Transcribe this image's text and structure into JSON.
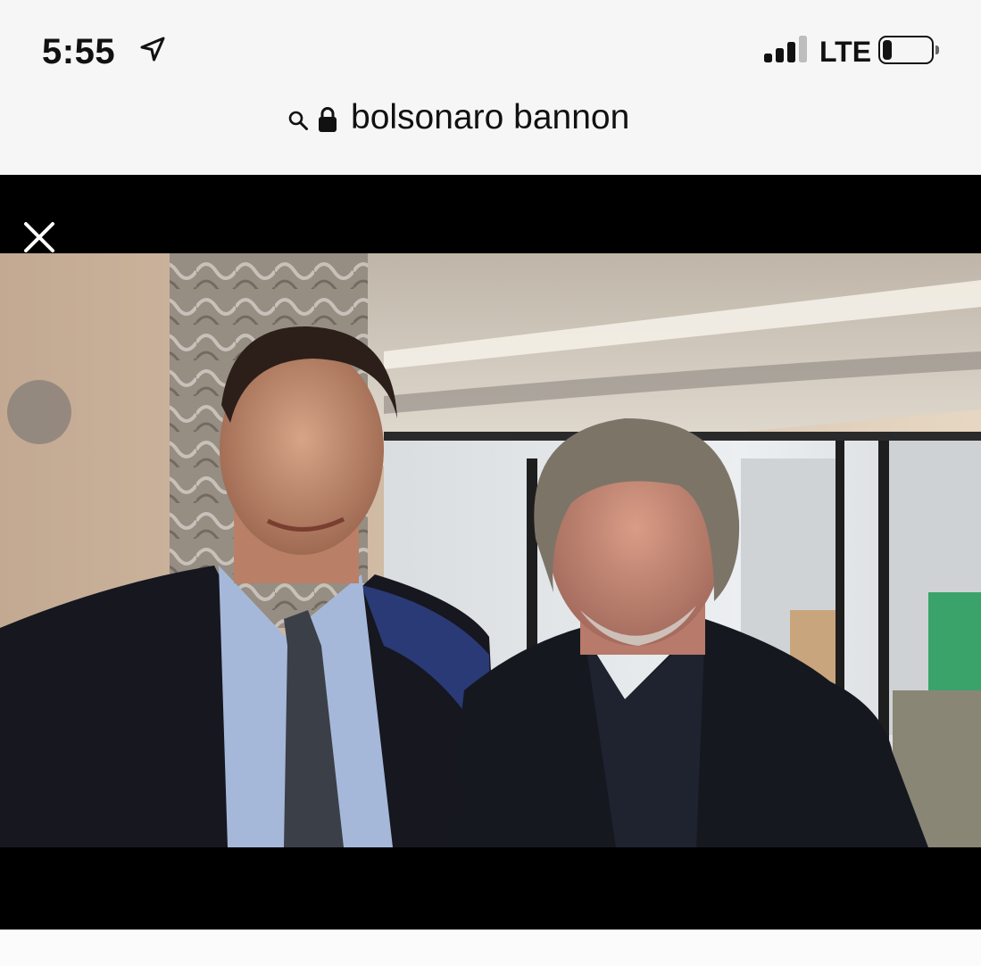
{
  "status_bar": {
    "time": "5:55",
    "carrier": "LTE",
    "location_icon": "location-arrow-icon",
    "signal_icon": "cellular-signal-icon",
    "battery_icon": "battery-icon",
    "signal_bars_active": 3,
    "signal_bars_total": 4,
    "battery_level": 0.2
  },
  "address_bar": {
    "search_icon": "search-icon",
    "lock_icon": "lock-icon",
    "query": "bolsonaro bannon"
  },
  "viewer": {
    "close_icon": "close-icon",
    "photo": "photo of two men in suits standing in front of a window"
  },
  "colors": {
    "background": "#f6f6f6",
    "viewer_bg": "#000000",
    "text": "#111111"
  }
}
